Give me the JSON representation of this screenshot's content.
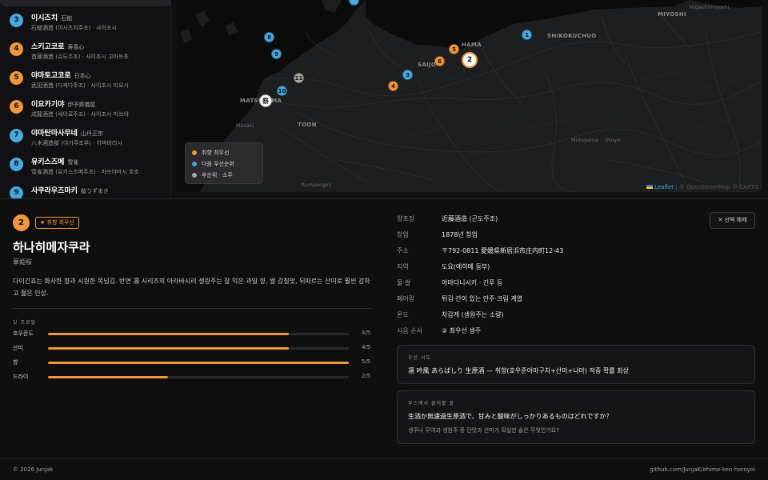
{
  "sidebar": {
    "items": [
      {
        "rank": "",
        "name": "",
        "kanji": "",
        "sub": "",
        "color": "#49a8e0",
        "selected": true
      },
      {
        "rank": "3",
        "name": "이시즈치",
        "kanji": "石鎚",
        "sub": "石鎚酒造 (이시즈치주조) · 사이조시",
        "color": "#49a8e0"
      },
      {
        "rank": "4",
        "name": "스키고코로",
        "kanji": "寿喜心",
        "sub": "首藤酒造 (슈도주조) · 사이조시 고마쓰초",
        "color": "#f0963c"
      },
      {
        "rank": "5",
        "name": "야마토고코로",
        "kanji": "日本心",
        "sub": "武田酒造 (다케다주조) · 사이조시 미요시",
        "color": "#f0963c"
      },
      {
        "rank": "6",
        "name": "이요카기야",
        "kanji": "伊予賀儀屋",
        "sub": "成龍酒造 (세이료주조) · 사이조시 미쓰야",
        "color": "#f0963c"
      },
      {
        "rank": "7",
        "name": "야마탄마사무네",
        "kanji": "山丹正宗",
        "sub": "八木酒造部 (야기주조부) · 이마바리시",
        "color": "#49a8e0"
      },
      {
        "rank": "8",
        "name": "유키스즈메",
        "kanji": "雪雀",
        "sub": "雪雀酒造 (유키스즈메주조) · 마쓰야마시 호조",
        "color": "#49a8e0"
      },
      {
        "rank": "9",
        "name": "사쿠라우즈마키",
        "kanji": "桜うずまき",
        "sub": "",
        "color": "#49a8e0"
      }
    ]
  },
  "map": {
    "labels": {
      "niihama": "HAMA",
      "saijo": "SAIJO",
      "shikokuchuo": "SHIKOKUCHUO",
      "miyoshi": "MIYOSHI",
      "higashimiyoshi": "Higashimiyoshi",
      "matsuyama": "MATSUYAMA",
      "masaki": "Masaki",
      "toon": "TOON",
      "kumakogen": "Kumakogen",
      "motoyama": "Motoyama",
      "otoyo": "Otoyo"
    },
    "markers": {
      "m1": "1",
      "m2": "2",
      "m3": "3",
      "m4": "4",
      "m5": "5",
      "m6": "6",
      "m8": "8",
      "m9": "9",
      "m10": "10",
      "m11": "11",
      "matsuri": "祭"
    },
    "legend": [
      {
        "label": "취향 최우선",
        "color": "#f0963c"
      },
      {
        "label": "다음 우선순위",
        "color": "#49a8e0"
      },
      {
        "label": "후순위 · 소주",
        "color": "#a8a89a"
      }
    ],
    "attribution_leaflet": "Leaflet",
    "attribution_rest": "| © OpenStreetMap © CARTO"
  },
  "detail": {
    "rank": "2",
    "badge": "★ 취향 최우선",
    "name": "하나히메자쿠라",
    "kanji": "華姫桜",
    "description": "다이긴죠는 화사한 향과 시원한 목넘김. 반면 凛 시리즈의 아라바시리 생원주는 잘 익은 과일 향, 쌀 감칠맛, 뒤따르는 산미로 훨씬 강하고 젊은 인상.",
    "taste_title": "맛 프로필",
    "taste": [
      {
        "label": "호우준도",
        "value": 4,
        "max": 5,
        "text": "4/5"
      },
      {
        "label": "산미",
        "value": 4,
        "max": 5,
        "text": "4/5"
      },
      {
        "label": "향",
        "value": 5,
        "max": 5,
        "text": "5/5"
      },
      {
        "label": "드라이",
        "value": 2,
        "max": 5,
        "text": "2/5"
      }
    ],
    "info": [
      {
        "k": "양조장",
        "v": "近藤酒造 (곤도주조)"
      },
      {
        "k": "창업",
        "v": "1878년 창업"
      },
      {
        "k": "주소",
        "v": "〒792-0811 愛媛県新居浜市庄内町12-43"
      },
      {
        "k": "지역",
        "v": "도요(에히메 동부)"
      },
      {
        "k": "물·쌀",
        "v": "야마다니시키 · 긴푸 등"
      },
      {
        "k": "페어링",
        "v": "튀김·간이 있는 안주·크림 계열"
      },
      {
        "k": "온도",
        "v": "차갑게 (생원주는 소량)"
      },
      {
        "k": "시음 순서",
        "v": "② 최우선 생주"
      }
    ],
    "clear_button": "✕  선택 해제",
    "priority_card": {
      "title": "우선 시도",
      "text": "凛 吟風 あらばしり 生原酒 — 취향(호우준아마구치+산미+나마) 적중 확률 최상"
    },
    "ask_card": {
      "title": "부스에서 물어볼 말",
      "question": "生酒か無濾過生原酒で、甘みと酸味がしっかりあるものはどれですか？",
      "translation": "생주나 무여과 생원주 중 단맛과 산미가 확실한 술은 무엇인가요?"
    }
  },
  "footer": {
    "copyright": "© 2026 Junjak",
    "github": "github.com/JunjaK/ehime-ken-horoyoi"
  }
}
